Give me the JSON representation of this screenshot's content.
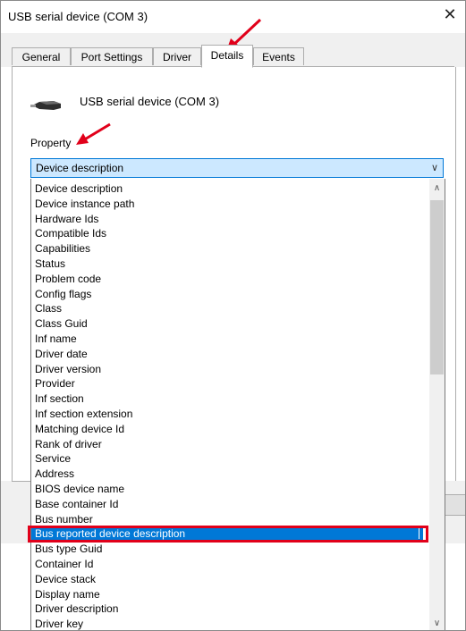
{
  "window": {
    "title": "USB serial device (COM 3)",
    "close_glyph": "✕"
  },
  "tabs": [
    {
      "label": "General"
    },
    {
      "label": "Port Settings"
    },
    {
      "label": "Driver"
    },
    {
      "label": "Details",
      "active": true
    },
    {
      "label": "Events"
    }
  ],
  "device": {
    "name": "USB serial device (COM 3)",
    "icon": "usb-cable-icon"
  },
  "property": {
    "label": "Property",
    "selected_value": "Device description",
    "dropdown_arrow": "chevron-down-icon"
  },
  "options": [
    "Device description",
    "Device instance path",
    "Hardware Ids",
    "Compatible Ids",
    "Capabilities",
    "Status",
    "Problem code",
    "Config flags",
    "Class",
    "Class Guid",
    "Inf name",
    "Driver date",
    "Driver version",
    "Provider",
    "Inf section",
    "Inf section extension",
    "Matching device Id",
    "Rank of driver",
    "Service",
    "Address",
    "BIOS device name",
    "Base container Id",
    "Bus number",
    "Bus reported device description",
    "Bus type Guid",
    "Container Id",
    "Device stack",
    "Display name",
    "Driver description",
    "Driver key"
  ],
  "highlighted_index": 23,
  "colors": {
    "selection": "#0078d7",
    "annotation_red": "#e1001a",
    "combo_fill": "#cce8ff"
  }
}
